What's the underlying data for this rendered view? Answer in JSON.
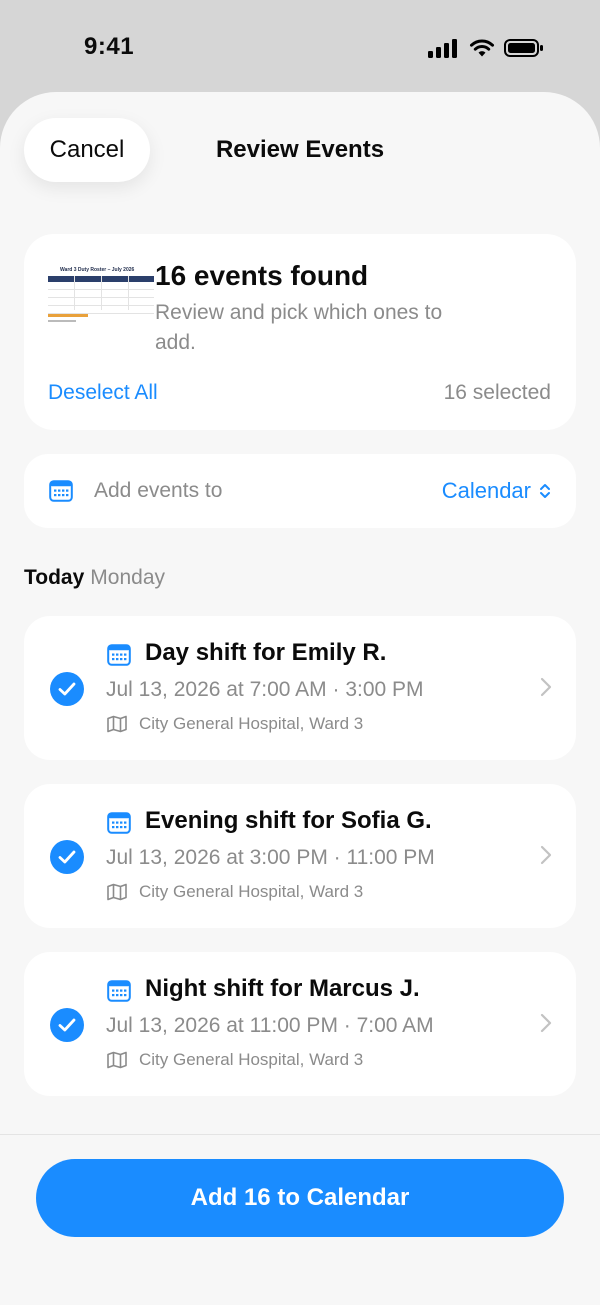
{
  "status_bar": {
    "time": "9:41"
  },
  "header": {
    "cancel_label": "Cancel",
    "title": "Review Events"
  },
  "summary": {
    "thumbnail_title": "Ward 3 Duty Roster – July 2026",
    "heading": "16 events found",
    "description": "Review and pick which ones to add.",
    "deselect_label": "Deselect All",
    "selected_count": "16 selected"
  },
  "calendar_picker": {
    "label": "Add events to",
    "value": "Calendar"
  },
  "section": {
    "day": "Today",
    "weekday": "Monday"
  },
  "events": [
    {
      "title": "Day shift for Emily R.",
      "time": "Jul 13, 2026 at 7:00 AM · 3:00 PM",
      "location": "City General Hospital, Ward 3",
      "checked": true
    },
    {
      "title": "Evening shift for Sofia G.",
      "time": "Jul 13, 2026 at 3:00 PM · 11:00 PM",
      "location": "City General Hospital, Ward 3",
      "checked": true
    },
    {
      "title": "Night shift for Marcus J.",
      "time": "Jul 13, 2026 at 11:00 PM · 7:00 AM",
      "location": "City General Hospital, Ward 3",
      "checked": true
    }
  ],
  "footer": {
    "add_label": "Add 16 to Calendar"
  },
  "colors": {
    "accent": "#1a8cff",
    "secondary_text": "#8b8b8b",
    "sheet_bg": "#f7f7f7"
  }
}
